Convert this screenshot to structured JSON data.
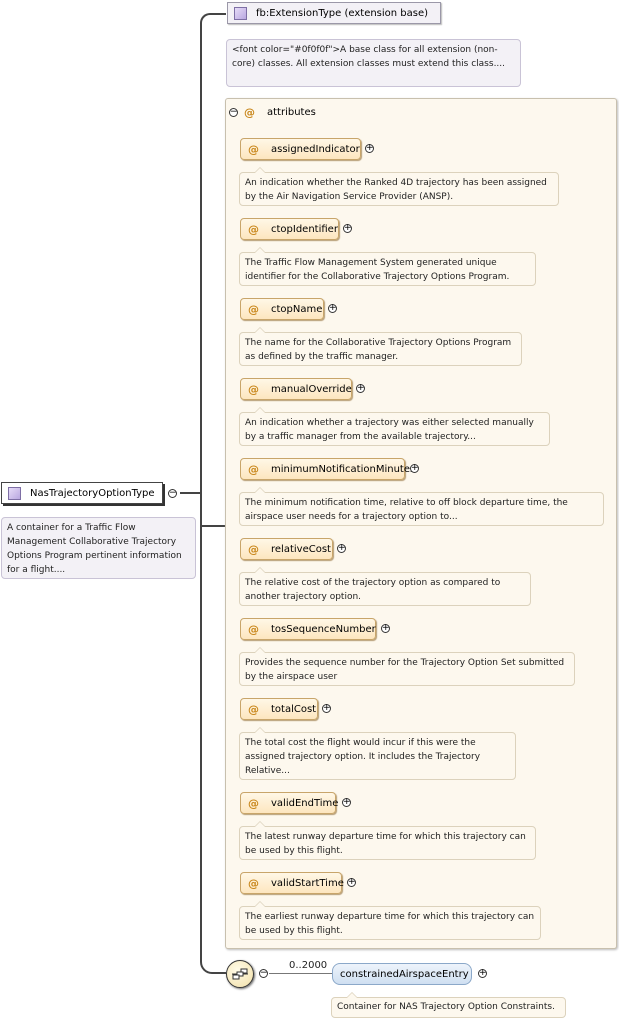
{
  "root": {
    "name": "NasTrajectoryOptionType",
    "doc": "A container for a Traffic Flow Management Collaborative Trajectory Options Program pertinent information for a flight...."
  },
  "base": {
    "name": "fb:ExtensionType (extension base)",
    "doc": "<font color=\"#0f0f0f\">A base class for all extension (non-core) classes. All extension classes must extend this class...."
  },
  "attributes_group": {
    "label": "attributes",
    "at_symbol": "@",
    "items": [
      {
        "name": "assignedIndicator",
        "doc": "An indication whether the Ranked 4D trajectory has been assigned by the Air Navigation Service Provider (ANSP)."
      },
      {
        "name": "ctopIdentifier",
        "doc": "The Traffic Flow Management System generated unique identifier for the Collaborative Trajectory Options Program."
      },
      {
        "name": "ctopName",
        "doc": "The name for the Collaborative Trajectory Options Program as defined by the traffic manager."
      },
      {
        "name": "manualOverride",
        "doc": "An indication whether a trajectory was either selected manually by a traffic manager from the available trajectory..."
      },
      {
        "name": "minimumNotificationMinutes",
        "doc": "The minimum notification time, relative to off block departure time, the airspace user needs for a trajectory option to..."
      },
      {
        "name": "relativeCost",
        "doc": "The relative cost of the trajectory option as compared to another trajectory option."
      },
      {
        "name": "tosSequenceNumber",
        "doc": "Provides the sequence number for the Trajectory Option Set submitted by the airspace user"
      },
      {
        "name": "totalCost",
        "doc": "The total cost the flight would incur if this were the assigned trajectory option. It includes the Trajectory Relative..."
      },
      {
        "name": "validEndTime",
        "doc": "The latest runway departure time for which this trajectory can be used by this flight."
      },
      {
        "name": "validStartTime",
        "doc": "The earliest runway departure time for which this trajectory can be used by this flight."
      }
    ]
  },
  "sequence": {
    "cardinality": "0..2000",
    "element": {
      "name": "constrainedAirspaceEntry",
      "doc": "Container for NAS Trajectory Option Constraints."
    }
  },
  "symbols": {
    "plus": "+",
    "minus": "−"
  }
}
